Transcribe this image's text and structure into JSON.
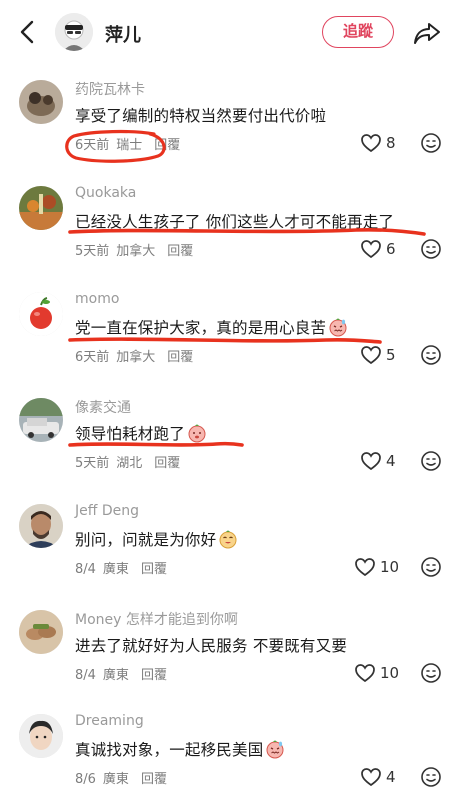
{
  "header": {
    "title": "萍儿",
    "follow_label": "追蹤"
  },
  "colors": {
    "accent": "#e0455f",
    "annotation_red": "#e8321e"
  },
  "comments": [
    {
      "username": "药院瓦林卡",
      "text": "享受了编制的特权当然要付出代价啦",
      "date": "6天前",
      "location": "瑞士",
      "reply": "回覆",
      "likes": "8"
    },
    {
      "username": "Quokaka",
      "text": "已经没人生孩子了 你们这些人才可不能再走了",
      "date": "5天前",
      "location": "加拿大",
      "reply": "回覆",
      "likes": "6"
    },
    {
      "username": "momo",
      "text": "党一直在保护大家，真的是用心良苦",
      "date": "6天前",
      "location": "加拿大",
      "reply": "回覆",
      "likes": "5"
    },
    {
      "username": "像素交通",
      "text": "领导怕耗材跑了",
      "date": "5天前",
      "location": "湖北",
      "reply": "回覆",
      "likes": "4"
    },
    {
      "username": "Jeff Deng",
      "text": "别问，问就是为你好",
      "date": "8/4",
      "location": "廣東",
      "reply": "回覆",
      "likes": "10"
    },
    {
      "username": "Money 怎样才能追到你啊",
      "text": "进去了就好好为人民服务 不要既有又要",
      "date": "8/4",
      "location": "廣東",
      "reply": "回覆",
      "likes": "10"
    },
    {
      "username": "Dreaming",
      "text": "真诚找对象，一起移民美国",
      "date": "8/6",
      "location": "廣東",
      "reply": "回覆",
      "likes": "4"
    }
  ]
}
